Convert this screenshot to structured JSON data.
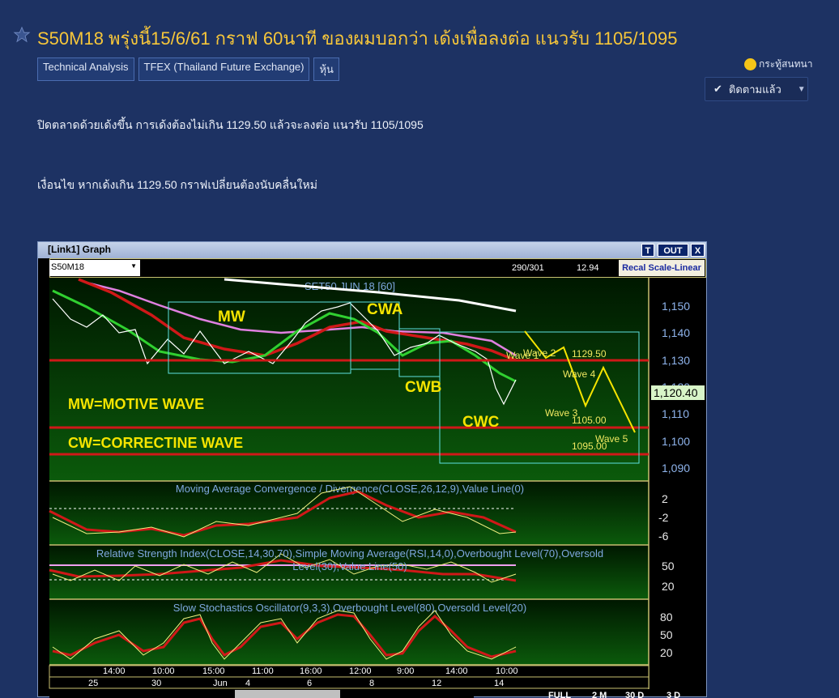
{
  "post": {
    "title": "S50M18 พรุ่งนี้15/6/61 กราฟ 60นาที ของผมบอกว่า เด้งเพื่อลงต่อ แนวรับ 1105/1095",
    "tags": [
      "Technical Analysis",
      "TFEX (Thailand Future Exchange)",
      "หุ้น"
    ],
    "chat_label": "กระทู้สนทนา",
    "follow_label": "ติดตามแล้ว",
    "paragraphs": [
      "ปิดตลาดด้วยเด้งขึ้น การเด้งต้องไม่เกิน 1129.50 แล้วจะลงต่อ แนวรับ 1105/1095",
      "เงื่อนไข หากเด้งเกิน 1129.50 กราฟเปลี่ยนต้องนับคลื่นใหม่"
    ]
  },
  "graph": {
    "window_title": "[Link1] Graph",
    "btn_t": "T",
    "btn_out": "OUT",
    "btn_x": "X",
    "symbol": "S50M18",
    "bars": "290/301",
    "value": "12.94",
    "recal": "Recal Scale-Linear",
    "main_title": "SET50 JUN 18   [60]",
    "price_ticks": [
      "1,150",
      "1,140",
      "1,130",
      "1,120",
      "1,110",
      "1,100",
      "1,090"
    ],
    "last_price": "1,120.40",
    "annotations": {
      "mw": "MW",
      "cwa": "CWA",
      "cwb": "CWB",
      "cwc": "CWC",
      "legend1": "MW=MOTIVE WAVE",
      "legend2": "CW=CORRECTINE WAVE",
      "wave1": "Wave 1",
      "wave2": "Wave 2",
      "wave3": "Wave 3",
      "wave4": "Wave 4",
      "wave5": "Wave 5",
      "r1": "1129.50",
      "s1": "1105.00",
      "s2": "1095.00"
    },
    "macd_title": "Moving Average Convergence / Divergence(CLOSE,26,12,9),Value Line(0)",
    "macd_ticks": [
      "2",
      "-2",
      "-6"
    ],
    "rsi_title1": "Relative Strength Index(CLOSE,14,30,70),Simple Moving Average(RSI,14,0),Overbought Level(70),Oversold",
    "rsi_title2": "Level(30),Value Line(50)",
    "rsi_ticks": [
      "50",
      "20"
    ],
    "stoch_title": "Slow Stochastics Oscillator(9,3,3),Overbought Level(80),Oversold Level(20)",
    "stoch_ticks": [
      "80",
      "50",
      "20"
    ],
    "time_labels": [
      "14:00",
      "10:00",
      "15:00",
      "11:00",
      "16:00",
      "12:00",
      "9:00",
      "14:00",
      "10:00"
    ],
    "date_labels": [
      "25",
      "30",
      "Jun",
      "4",
      "6",
      "8",
      "12",
      "14"
    ],
    "range_buttons": [
      "FULL",
      "2 M",
      "30 D",
      "3 D"
    ]
  },
  "colors": {
    "bg": "#1d3263",
    "title": "#f6c63a",
    "annot": "#f5e400"
  }
}
